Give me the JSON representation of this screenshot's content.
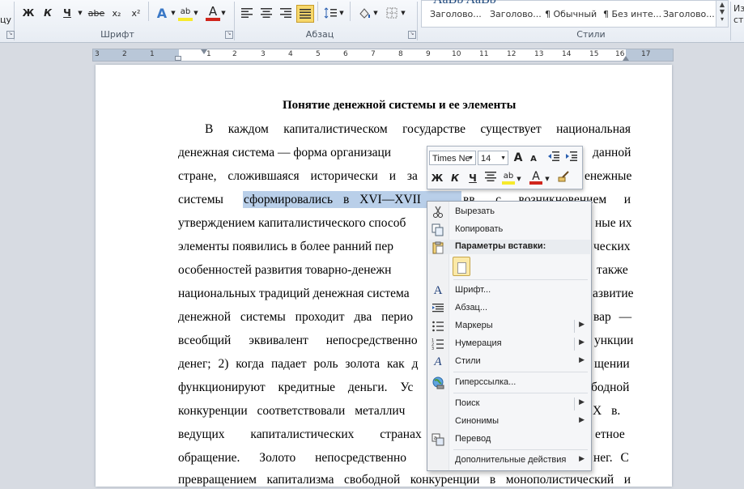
{
  "ribbon": {
    "cut_fragment": "цу",
    "font_group_label": "Шрифт",
    "paragraph_group_label": "Абзац",
    "styles_group_label": "Стили",
    "font_buttons": {
      "bold": "Ж",
      "italic": "К",
      "underline": "Ч",
      "strikethrough": "abe",
      "subscript": "x₂",
      "superscript": "x²",
      "text_effects": "A",
      "highlight": "ab",
      "font_color": "A"
    },
    "styles": [
      "Заголово...",
      "Заголово...",
      "¶ Обычный",
      "¶ Без инте...",
      "Заголово..."
    ],
    "styles_preview_fragment": "AaBb  AaBb",
    "more_fragment": "Из",
    "more_fragment2": "сти"
  },
  "ruler": {
    "numbers": [
      "3",
      "2",
      "1",
      "1",
      "2",
      "3",
      "4",
      "5",
      "6",
      "7",
      "8",
      "9",
      "10",
      "11",
      "12",
      "13",
      "14",
      "15",
      "16",
      "17"
    ]
  },
  "document": {
    "title": "Понятие денежной системы и ее элементы",
    "lines": [
      "В каждом капиталистическом государстве существует национальная",
      "денежная система — форма организаци",
      "стране, сложившаяся исторически и за",
      "системы",
      "утверждением капиталистического способ",
      "элементы появились в более ранний пер",
      "особенностей развития товарно-денежн",
      "национальных традиций денежная система",
      "денежной системы проходит два перио",
      "всеобщий эквивалент непосредственно",
      "денег; 2) когда падает роль золота как д",
      "функционируют кредитные деньги. Ус",
      "конкуренции соответствовали металлич",
      "ведущих капиталистических странах",
      "обращение. Золото непосредственно",
      "превращением капитализма свободной конкуренции в монополистический и"
    ],
    "line_ends": {
      "l1": "данной",
      "l2": "енежные",
      "l3_after": "вв. с возникновением и",
      "l4": "ные их",
      "l5": "ческих",
      "l6": "также",
      "l7": "азвитие",
      "l8": "вар —",
      "l9": "ункции",
      "l10": "щении",
      "l11": "бодной",
      "l12": "X в.",
      "l13": "етное",
      "l14": "нег. С"
    },
    "selected_text": "сформировались в XVI—XVII"
  },
  "mini_toolbar": {
    "font_name": "Times Ne",
    "font_size": "14",
    "grow": "A",
    "shrink": "A",
    "bold": "Ж",
    "italic": "К",
    "underline": "Ч",
    "highlight": "ab",
    "font_color": "A"
  },
  "context_menu": {
    "cut": "Вырезать",
    "copy": "Копировать",
    "paste_options": "Параметры вставки:",
    "font": "Шрифт...",
    "paragraph": "Абзац...",
    "bullets": "Маркеры",
    "numbering": "Нумерация",
    "styles": "Стили",
    "hyperlink": "Гиперссылка...",
    "search": "Поиск",
    "synonyms": "Синонимы",
    "translate": "Перевод",
    "additional_actions": "Дополнительные действия"
  },
  "colors": {
    "selection": "#b9cfe9",
    "font_color_red": "#d0251c",
    "highlight_yellow": "#f7ea2c",
    "ribbon_bg": "#e7ecf3"
  }
}
